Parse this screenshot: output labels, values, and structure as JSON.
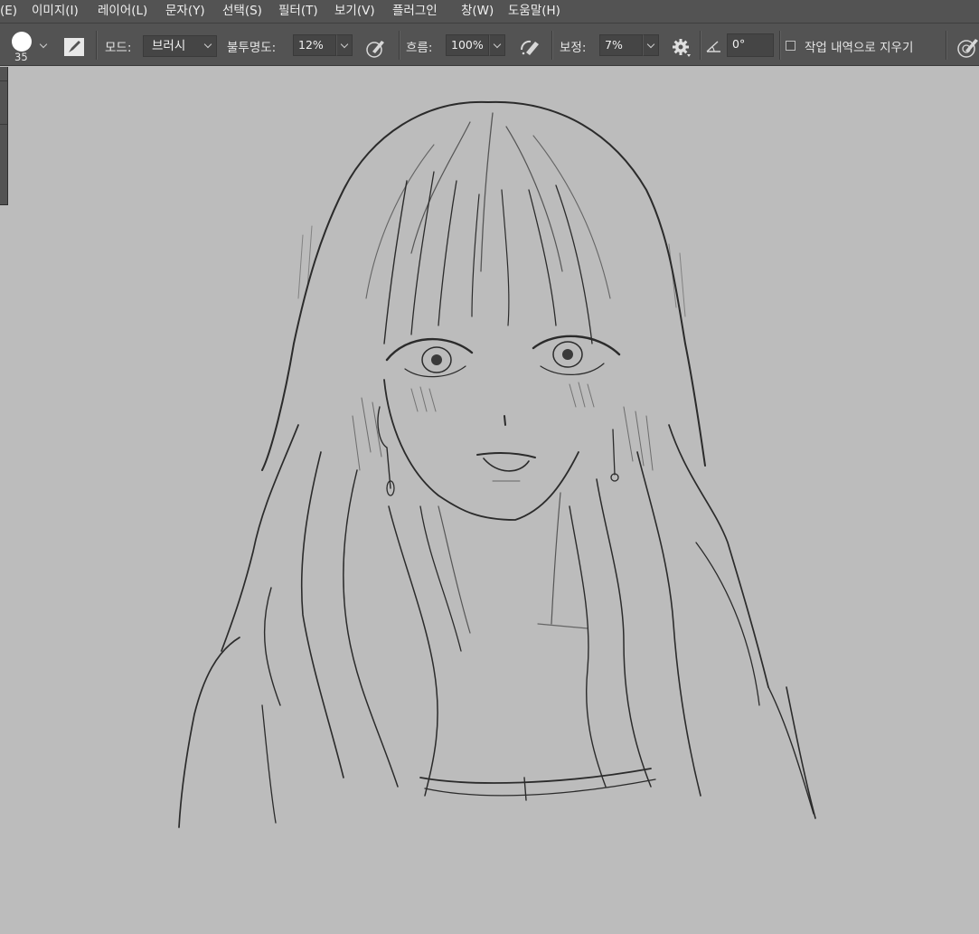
{
  "menu": {
    "items": [
      "(E)",
      "이미지(I)",
      "레이어(L)",
      "문자(Y)",
      "선택(S)",
      "필터(T)",
      "보기(V)",
      "플러그인",
      "창(W)",
      "도움말(H)"
    ]
  },
  "options": {
    "brush_size": "35",
    "mode_label": "모드:",
    "mode_value": "브러시",
    "opacity_label": "불투명도:",
    "opacity_value": "12%",
    "flow_label": "흐름:",
    "flow_value": "100%",
    "smoothing_label": "보정:",
    "smoothing_value": "7%",
    "angle_value": "0°",
    "erase_history_label": "작업 내역으로 지우기",
    "erase_history_checked": false
  },
  "icons": {
    "brush_tip": "brush-tip-icon",
    "brush_panel": "brush-settings-panel-icon",
    "pressure_opacity": "pressure-opacity-icon",
    "airbrush": "airbrush-icon",
    "settings": "gear-icon",
    "angle": "angle-icon",
    "pressure_size": "pressure-size-icon"
  },
  "colors": {
    "ui_bg": "#535353",
    "field_bg": "#454545",
    "canvas_bg": "#bcbcbc",
    "sketch_line": "#2b2b2b"
  }
}
